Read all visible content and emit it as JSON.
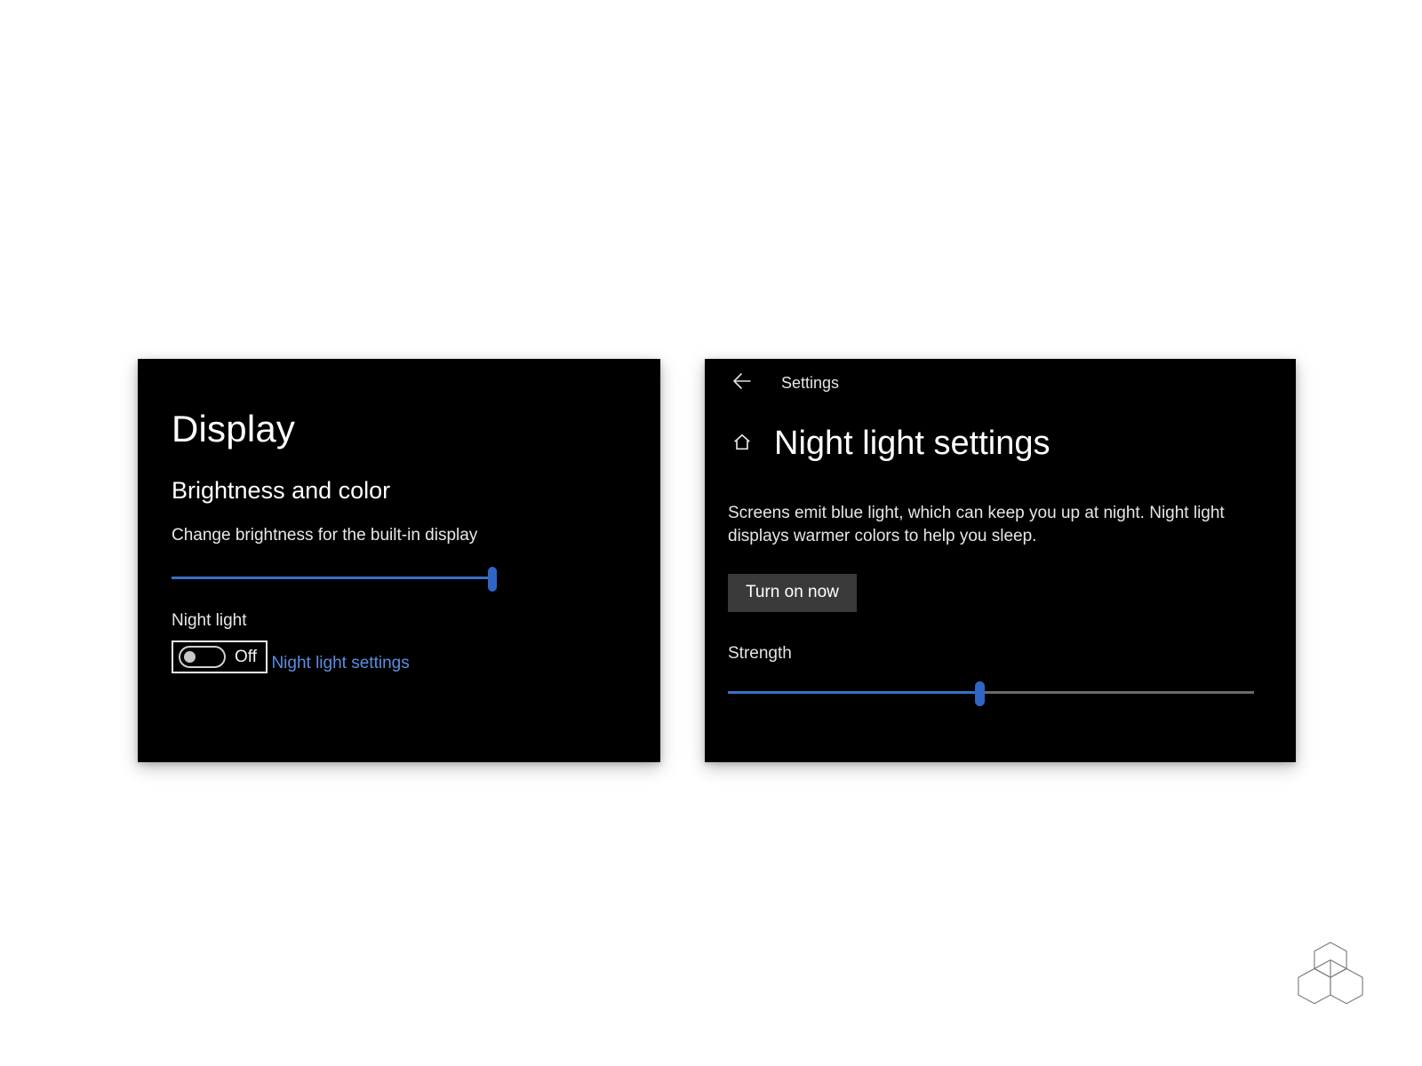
{
  "left_panel": {
    "title": "Display",
    "section_heading": "Brightness and color",
    "brightness_label": "Change brightness for the built-in display",
    "brightness_value_percent": 98,
    "night_light_label": "Night light",
    "night_light_state_text": "Off",
    "night_light_state": false,
    "night_light_settings_link": "Night light settings"
  },
  "right_panel": {
    "topbar_label": "Settings",
    "title": "Night light settings",
    "description": "Screens emit blue light, which can keep you up at night. Night light displays warmer colors to help you sleep.",
    "turn_on_button": "Turn on now",
    "strength_label": "Strength",
    "strength_value_percent": 48
  },
  "colors": {
    "panel_bg": "#000000",
    "accent": "#3b6fc9",
    "link": "#5b8ee0",
    "button_bg": "#3a3a3a"
  }
}
